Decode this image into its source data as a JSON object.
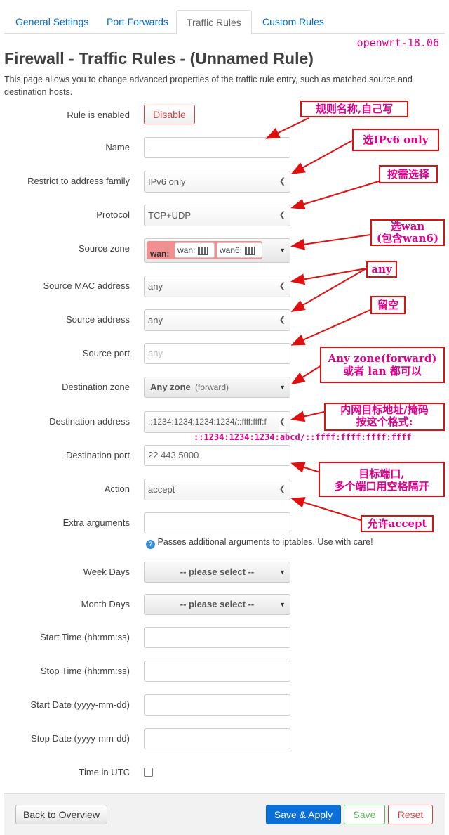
{
  "tabs": [
    "General Settings",
    "Port Forwards",
    "Traffic Rules",
    "Custom Rules"
  ],
  "version_note": "openwrt-18.06",
  "page_title": "Firewall - Traffic Rules - (Unnamed Rule)",
  "description": "This page allows you to change advanced properties of the traffic rule entry, such as matched source and destination hosts.",
  "fields": {
    "rule_enabled": {
      "label": "Rule is enabled",
      "button": "Disable"
    },
    "name": {
      "label": "Name",
      "value": "-"
    },
    "family": {
      "label": "Restrict to address family",
      "value": "IPv6 only"
    },
    "protocol": {
      "label": "Protocol",
      "value": "TCP+UDP"
    },
    "source_zone": {
      "label": "Source zone",
      "zone": "wan:",
      "tag1": "wan:",
      "tag2": "wan6:"
    },
    "source_mac": {
      "label": "Source MAC address",
      "value": "any"
    },
    "source_address": {
      "label": "Source address",
      "value": "any"
    },
    "source_port": {
      "label": "Source port",
      "placeholder": "any"
    },
    "dest_zone": {
      "label": "Destination zone",
      "zone": "Any zone",
      "extra": "(forward)"
    },
    "dest_address": {
      "label": "Destination address",
      "value": "::1234:1234:1234:1234/::ffff:ffff:f"
    },
    "dest_port": {
      "label": "Destination port",
      "value": "22 443 5000"
    },
    "action": {
      "label": "Action",
      "value": "accept"
    },
    "extra_args": {
      "label": "Extra arguments",
      "hint": "Passes additional arguments to iptables. Use with care!"
    },
    "week_days": {
      "label": "Week Days",
      "value": "-- please select --"
    },
    "month_days": {
      "label": "Month Days",
      "value": "-- please select --"
    },
    "start_time": {
      "label": "Start Time (hh:mm:ss)"
    },
    "stop_time": {
      "label": "Stop Time (hh:mm:ss)"
    },
    "start_date": {
      "label": "Start Date (yyyy-mm-dd)"
    },
    "stop_date": {
      "label": "Stop Date (yyyy-mm-dd)"
    },
    "utc": {
      "label": "Time in UTC"
    }
  },
  "footer": {
    "back": "Back to Overview",
    "save_apply": "Save & Apply",
    "save": "Save",
    "reset": "Reset"
  },
  "annotations": {
    "a1": "规则名称,自己写",
    "a2": "选IPv6 only",
    "a3": "按需选择",
    "a4_l1": "选wan",
    "a4_l2": "(包含wan6)",
    "a5": "any",
    "a6": "留空",
    "a7_l1": "Any zone(forward)",
    "a7_l2": "或者 lan 都可以",
    "a8_l1": "内网目标地址/掩码",
    "a8_l2": "按这个格式:",
    "a8_l3": "::1234:1234:1234:abcd/::ffff:ffff:ffff:ffff",
    "a9_l1": "目标端口,",
    "a9_l2": "多个端口用空格隔开",
    "a10": "允许accept"
  },
  "colors": {
    "link": "#0069d6",
    "annotation_text": "#e0008c",
    "annotation_border": "#e01010",
    "primary_button": "#0b6fd8"
  }
}
